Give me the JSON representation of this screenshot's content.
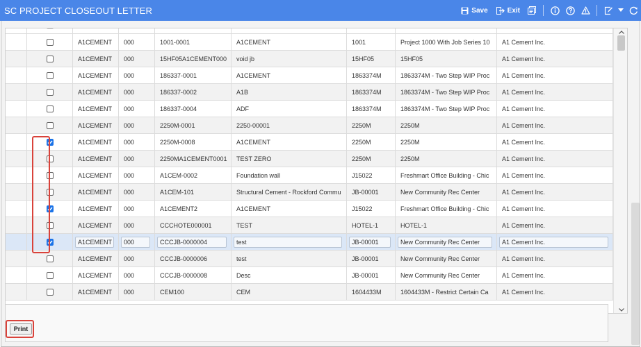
{
  "titlebar": {
    "title": "SC PROJECT CLOSEOUT LETTER",
    "save_label": "Save",
    "exit_label": "Exit"
  },
  "grid": {
    "rows": [
      {
        "checked": false,
        "c1": "A1CEMENT",
        "c2": "000",
        "c3": "1001-0001",
        "c4": "A1CEMENT",
        "c5": "1001",
        "c6": "Project 1000 With Job Series 10",
        "c7": "A1 Cement Inc."
      },
      {
        "checked": false,
        "c1": "A1CEMENT",
        "c2": "000",
        "c3": "15HF05A1CEMENT000",
        "c4": "void jb",
        "c5": "15HF05",
        "c6": "15HF05",
        "c7": "A1 Cement Inc."
      },
      {
        "checked": false,
        "c1": "A1CEMENT",
        "c2": "000",
        "c3": "186337-0001",
        "c4": "A1CEMENT",
        "c5": "1863374M",
        "c6": "1863374M - Two Step WIP Proc",
        "c7": "A1 Cement Inc."
      },
      {
        "checked": false,
        "c1": "A1CEMENT",
        "c2": "000",
        "c3": "186337-0002",
        "c4": "A1B",
        "c5": "1863374M",
        "c6": "1863374M - Two Step WIP Proc",
        "c7": "A1 Cement Inc."
      },
      {
        "checked": false,
        "c1": "A1CEMENT",
        "c2": "000",
        "c3": "186337-0004",
        "c4": "ADF",
        "c5": "1863374M",
        "c6": "1863374M - Two Step WIP Proc",
        "c7": "A1 Cement Inc."
      },
      {
        "checked": false,
        "c1": "A1CEMENT",
        "c2": "000",
        "c3": "2250M-0001",
        "c4": "2250-00001",
        "c5": "2250M",
        "c6": "2250M",
        "c7": "A1 Cement Inc."
      },
      {
        "checked": true,
        "c1": "A1CEMENT",
        "c2": "000",
        "c3": "2250M-0008",
        "c4": "A1CEMENT",
        "c5": "2250M",
        "c6": "2250M",
        "c7": "A1 Cement Inc."
      },
      {
        "checked": false,
        "c1": "A1CEMENT",
        "c2": "000",
        "c3": "2250MA1CEMENT0001",
        "c4": "TEST ZERO",
        "c5": "2250M",
        "c6": "2250M",
        "c7": "A1 Cement Inc."
      },
      {
        "checked": false,
        "c1": "A1CEMENT",
        "c2": "000",
        "c3": "A1CEM-0002",
        "c4": "Foundation wall",
        "c5": "J15022",
        "c6": "Freshmart Office Building - Chic",
        "c7": "A1 Cement Inc."
      },
      {
        "checked": false,
        "c1": "A1CEMENT",
        "c2": "000",
        "c3": "A1CEM-101",
        "c4": "Structural Cement - Rockford Commu",
        "c5": "JB-00001",
        "c6": "New Community Rec Center",
        "c7": "A1 Cement Inc."
      },
      {
        "checked": true,
        "c1": "A1CEMENT",
        "c2": "000",
        "c3": "A1CEMENT2",
        "c4": "A1CEMENT",
        "c5": "J15022",
        "c6": "Freshmart Office Building - Chic",
        "c7": "A1 Cement Inc."
      },
      {
        "checked": false,
        "c1": "A1CEMENT",
        "c2": "000",
        "c3": "CCCHOTE000001",
        "c4": "TEST",
        "c5": "HOTEL-1",
        "c6": "HOTEL-1",
        "c7": "A1 Cement Inc."
      },
      {
        "checked": true,
        "c1": "A1CEMENT",
        "c2": "000",
        "c3": "CCCJB-0000004",
        "c4": "test",
        "c5": "JB-00001",
        "c6": "New Community Rec Center",
        "c7": "A1 Cement Inc."
      },
      {
        "checked": false,
        "c1": "A1CEMENT",
        "c2": "000",
        "c3": "CCCJB-0000006",
        "c4": "test",
        "c5": "JB-00001",
        "c6": "New Community Rec Center",
        "c7": "A1 Cement Inc."
      },
      {
        "checked": false,
        "c1": "A1CEMENT",
        "c2": "000",
        "c3": "CCCJB-0000008",
        "c4": "Desc",
        "c5": "JB-00001",
        "c6": "New Community Rec Center",
        "c7": "A1 Cement Inc."
      },
      {
        "checked": false,
        "c1": "A1CEMENT",
        "c2": "000",
        "c3": "CEM100",
        "c4": "CEM",
        "c5": "1604433M",
        "c6": "1604433M - Restrict Certain Ca",
        "c7": "A1 Cement Inc."
      }
    ]
  },
  "footer": {
    "print_label": "Print"
  },
  "colors": {
    "titlebar": "#4a86e8",
    "highlight": "#d9423a",
    "checkbox_checked": "#1a73e8",
    "selected_row": "#dbe7f7"
  },
  "icons": [
    "save-icon",
    "exit-icon",
    "report-icon",
    "info-icon",
    "help-icon",
    "warning-icon",
    "edit-icon",
    "dropdown-icon",
    "refresh-icon"
  ]
}
